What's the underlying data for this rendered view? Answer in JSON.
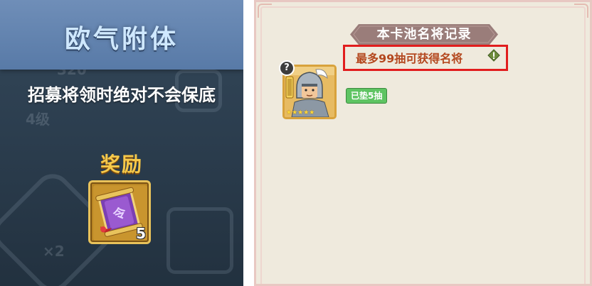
{
  "left_panel": {
    "title": "欧气附体",
    "description": "招募将领时绝对不会保底",
    "reward_label": "奖励",
    "reward_item": {
      "icon": "purple-scroll-icon",
      "count": "5"
    },
    "background_ghost_text": {
      "top_number": "320",
      "level": "4级",
      "multiplier": "×2"
    }
  },
  "right_panel": {
    "title": "本卡池名将记录",
    "limit_text": "最多99抽可获得名将",
    "hint_icon": "exclamation-icon",
    "hero": {
      "help_symbol": "?",
      "stars": "★★★★★",
      "pity_badge": "已垫5抽"
    }
  },
  "colors": {
    "left_bg": "#2c3e4f",
    "title_bar": "#587aa7",
    "reward_gold": "#f6c94a",
    "right_bg": "#efeadd",
    "ribbon": "#9a7d7a",
    "highlight_red": "#e11d1d",
    "limit_text": "#b4481f",
    "pity_green": "#5ec462"
  }
}
